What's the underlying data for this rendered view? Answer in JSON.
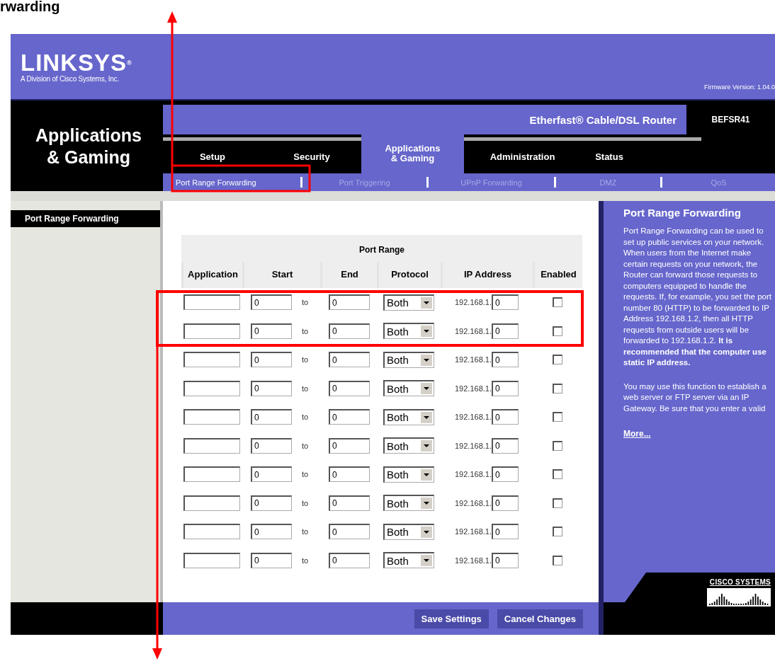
{
  "caption": "rwarding",
  "header": {
    "logo": "LINKSYS",
    "logo_mark": "®",
    "tagline": "A Division of Cisco Systems, Inc.",
    "firmware": "Firmware Version: 1.04.0"
  },
  "section_title": "Applications & Gaming",
  "product": {
    "name": "Etherfast® Cable/DSL Router",
    "model": "BEFSR41"
  },
  "tabs": [
    {
      "label": "Setup",
      "selected": false
    },
    {
      "label": "Security",
      "selected": false
    },
    {
      "label": "Applications\n& Gaming",
      "selected": true
    },
    {
      "label": "Administration",
      "selected": false
    },
    {
      "label": "Status",
      "selected": false
    }
  ],
  "subtabs": [
    {
      "label": "Port Range Forwarding",
      "selected": true
    },
    {
      "label": "Port Triggering",
      "selected": false
    },
    {
      "label": "UPnP Forwarding",
      "selected": false
    },
    {
      "label": "DMZ",
      "selected": false
    },
    {
      "label": "QoS",
      "selected": false
    }
  ],
  "sidebar": {
    "heading": "Port Range Forwarding"
  },
  "table": {
    "group_heading": "Port Range",
    "columns": [
      "Application",
      "Start",
      "End",
      "Protocol",
      "IP Address",
      "Enabled"
    ],
    "rows": [
      {
        "start": "0",
        "to": "to",
        "end": "0",
        "protocol": "Both",
        "ip_prefix": "192.168.1.",
        "ip_last": "0",
        "enabled": false
      },
      {
        "start": "0",
        "to": "to",
        "end": "0",
        "protocol": "Both",
        "ip_prefix": "192.168.1.",
        "ip_last": "0",
        "enabled": false
      },
      {
        "start": "0",
        "to": "to",
        "end": "0",
        "protocol": "Both",
        "ip_prefix": "192.168.1.",
        "ip_last": "0",
        "enabled": false
      },
      {
        "start": "0",
        "to": "to",
        "end": "0",
        "protocol": "Both",
        "ip_prefix": "192.168.1.",
        "ip_last": "0",
        "enabled": false
      },
      {
        "start": "0",
        "to": "to",
        "end": "0",
        "protocol": "Both",
        "ip_prefix": "192.168.1.",
        "ip_last": "0",
        "enabled": false
      },
      {
        "start": "0",
        "to": "to",
        "end": "0",
        "protocol": "Both",
        "ip_prefix": "192.168.1.",
        "ip_last": "0",
        "enabled": false
      },
      {
        "start": "0",
        "to": "to",
        "end": "0",
        "protocol": "Both",
        "ip_prefix": "192.168.1.",
        "ip_last": "0",
        "enabled": false
      },
      {
        "start": "0",
        "to": "to",
        "end": "0",
        "protocol": "Both",
        "ip_prefix": "192.168.1.",
        "ip_last": "0",
        "enabled": false
      },
      {
        "start": "0",
        "to": "to",
        "end": "0",
        "protocol": "Both",
        "ip_prefix": "192.168.1.",
        "ip_last": "0",
        "enabled": false
      },
      {
        "start": "0",
        "to": "to",
        "end": "0",
        "protocol": "Both",
        "ip_prefix": "192.168.1.",
        "ip_last": "0",
        "enabled": false
      }
    ]
  },
  "help": {
    "heading": "Port Range Forwarding",
    "paragraphs": [
      "Port Range Forwarding can be used to set up public services on your network. When users from the Internet make certain requests on your network, the Router can forward those requests to computers equipped to handle the requests. If, for example, you set the port number 80 (HTTP) to be forwarded to IP Address 192.168.1.2, then all HTTP requests from outside users will be forwarded to 192.168.1.2. **It is recommended that the computer use static IP address.**",
      "You may use this function to establish a web server or FTP server via an IP Gateway. Be sure that you enter a valid"
    ],
    "link": "More...",
    "brand": "CISCO SYSTEMS"
  },
  "buttons": [
    "Save Settings",
    "Cancel Changes"
  ]
}
